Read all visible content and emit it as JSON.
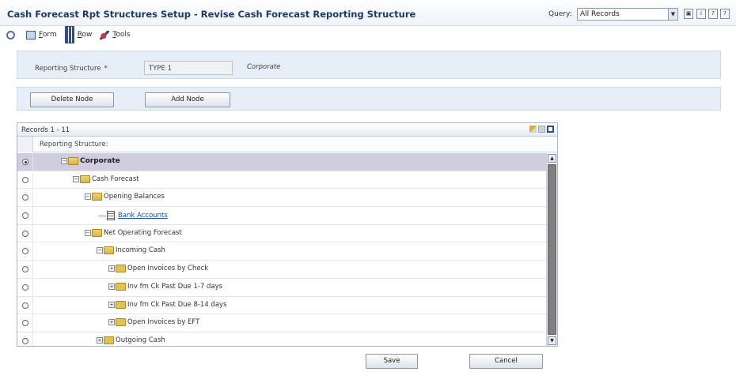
{
  "title": "Cash Forecast Rpt Structures Setup - Revise Cash Forecast Reporting Structure",
  "query": {
    "label": "Query:",
    "value": "All Records"
  },
  "toolbar": {
    "form": "Form",
    "row": "Row",
    "tools": "Tools"
  },
  "header_icons": [
    "lock-icon",
    "info-icon",
    "help-icon",
    "help-icon"
  ],
  "reporting_structure": {
    "label": "Reporting Structure",
    "required_mark": "*",
    "value": "TYPE 1",
    "description": "Corporate"
  },
  "buttons": {
    "delete_node": "Delete Node",
    "add_node": "Add Node",
    "save": "Save",
    "cancel": "Cancel"
  },
  "grid": {
    "records": "Records 1 - 11",
    "column": "Reporting Structure:",
    "rows": [
      {
        "label": "Corporate",
        "selected": true
      },
      {
        "label": "Cash Forecast"
      },
      {
        "label": "Opening Balances"
      },
      {
        "label": "Bank Accounts"
      },
      {
        "label": "Net Operating Forecast"
      },
      {
        "label": "Incoming Cash"
      },
      {
        "label": "Open Invoices by Check"
      },
      {
        "label": "Inv fm Ck Past Due 1-7 days"
      },
      {
        "label": "Inv fm Ck Past Due 8-14 days"
      },
      {
        "label": "Open Invoices by EFT"
      },
      {
        "label": "Outgoing Cash"
      }
    ]
  }
}
